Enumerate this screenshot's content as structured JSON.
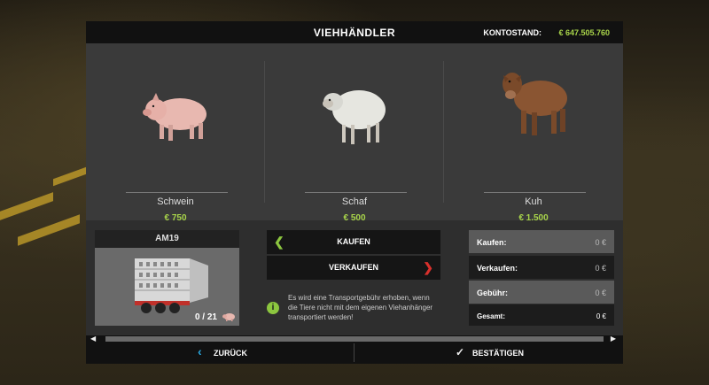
{
  "header": {
    "title": "VIEHHÄNDLER",
    "account_label": "KONTOSTAND:",
    "account_value": "€ 647.505.760"
  },
  "animals": [
    {
      "name": "Schwein",
      "price": "€ 750",
      "icon": "pig"
    },
    {
      "name": "Schaf",
      "price": "€ 500",
      "icon": "sheep"
    },
    {
      "name": "Kuh",
      "price": "€ 1.500",
      "icon": "cow"
    }
  ],
  "trailer": {
    "name": "AM19",
    "count": "0 / 21",
    "icon": "pig-icon"
  },
  "actions": {
    "buy_label": "KAUFEN",
    "sell_label": "VERKAUFEN"
  },
  "info_text": "Es wird eine Transportgebühr erhoben, wenn die Tiere nicht mit dem eigenen Viehanhänger transportiert werden!",
  "costs": [
    {
      "label": "Kaufen:",
      "value": "0 €"
    },
    {
      "label": "Verkaufen:",
      "value": "0 €"
    },
    {
      "label": "Gebühr:",
      "value": "0 €"
    },
    {
      "label": "Gesamt:",
      "value": "0 €"
    }
  ],
  "footer": {
    "back_label": "ZURÜCK",
    "confirm_label": "BESTÄTIGEN"
  },
  "colors": {
    "accent_green": "#a8d44a",
    "back_blue": "#29a8e0",
    "sell_red": "#d9302c"
  }
}
